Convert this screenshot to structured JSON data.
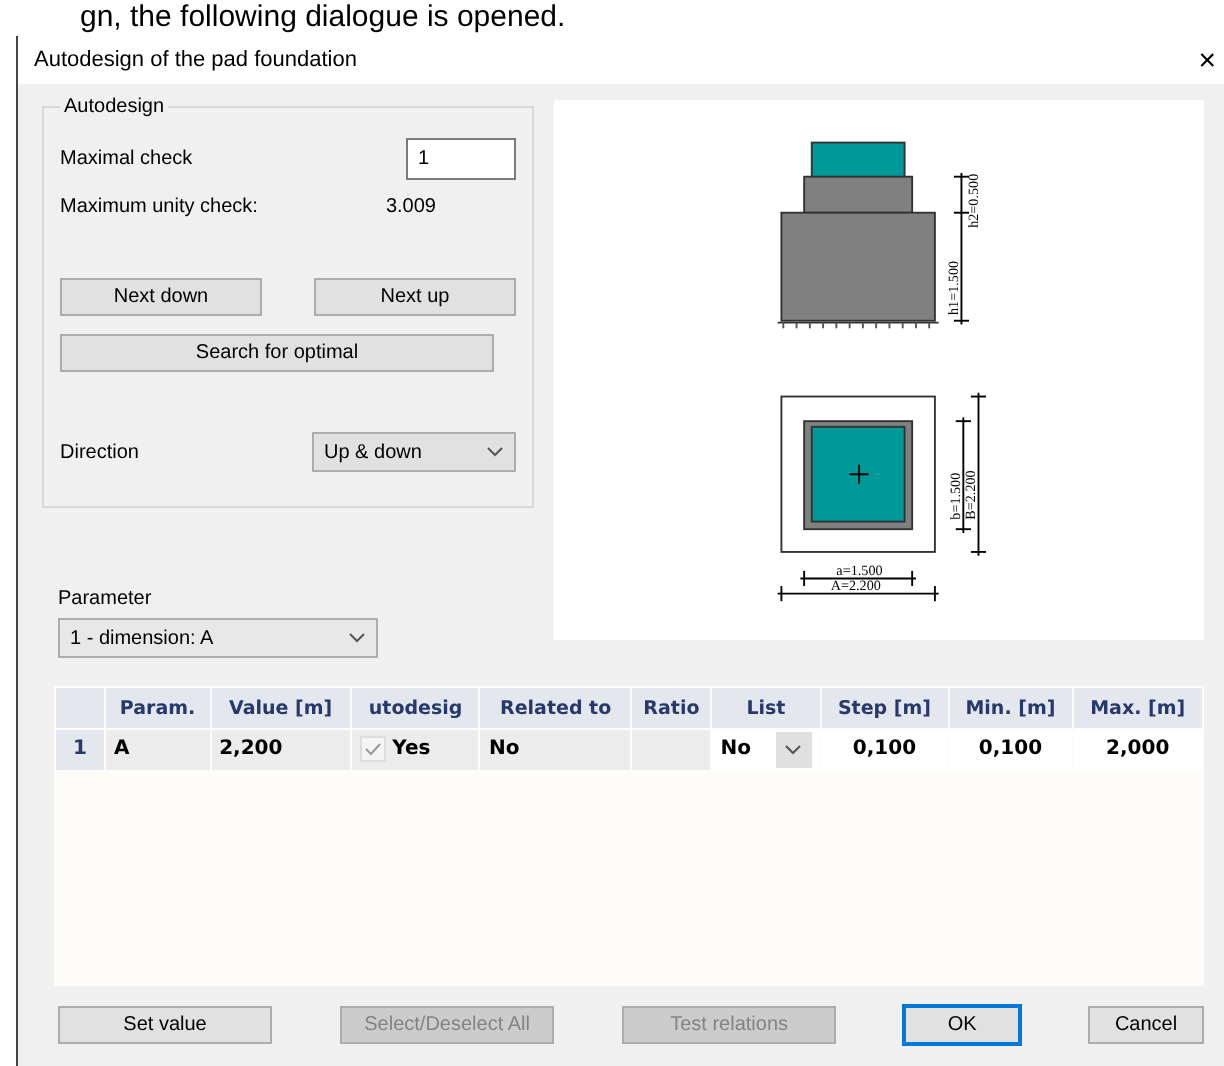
{
  "caption": "gn, the following dialogue is opened.",
  "window": {
    "title": "Autodesign of the pad foundation",
    "close": "×"
  },
  "autodesign": {
    "title": "Autodesign",
    "maximal_check": {
      "label": "Maximal check",
      "value": "1"
    },
    "unity": {
      "label": "Maximum unity check:",
      "value": "3.009"
    },
    "buttons": [
      {
        "label": "Next down"
      },
      {
        "label": "Next up"
      },
      {
        "label": "Search for optimal"
      }
    ],
    "direction": {
      "label": "Direction",
      "value": "Up & down"
    }
  },
  "drawing": {
    "h2": "h2=0.500",
    "h1": "h1=1.500",
    "b": "b=1.500",
    "B": "B=2.200",
    "a": "a=1.500",
    "A": "A=2.200"
  },
  "parameter": {
    "label": "Parameter",
    "value": "1 - dimension: A"
  },
  "table": {
    "columns": [
      "Param.",
      "Value [m]",
      "utodesig",
      "Related to",
      "Ratio",
      "List",
      "Step [m]",
      "Min. [m]",
      "Max. [m]"
    ],
    "rows": [
      {
        "index": "1",
        "param": "A",
        "value": "2,200",
        "autodesign": {
          "checked": true,
          "label": "Yes"
        },
        "related_to": "No",
        "list": "No",
        "step": "0,100",
        "min": "0,100",
        "max": "2,000"
      }
    ]
  },
  "buttons": [
    {
      "label": "Set value",
      "disabled": false,
      "default": false
    },
    {
      "label": "Select/Deselect All",
      "disabled": true,
      "default": false
    },
    {
      "label": "Test relations",
      "disabled": true,
      "default": false
    },
    {
      "label": "OK",
      "disabled": false,
      "default": true
    },
    {
      "label": "Cancel",
      "disabled": false,
      "default": false
    }
  ]
}
